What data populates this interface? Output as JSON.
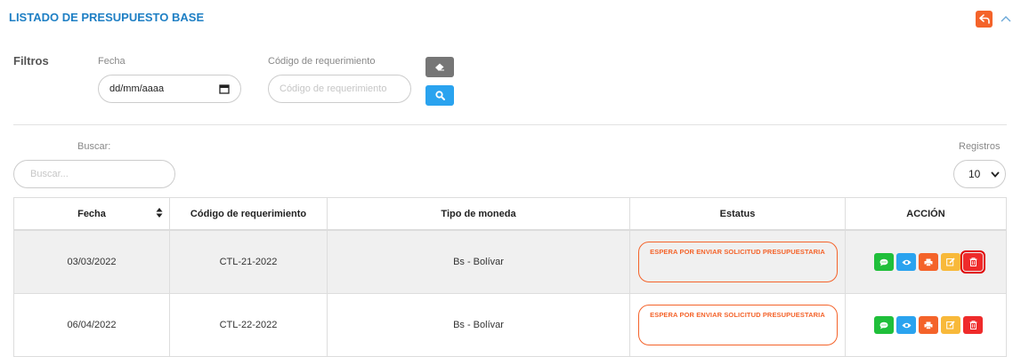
{
  "header": {
    "title": "LISTADO DE PRESUPUESTO BASE",
    "back_icon": "reply-arrow-icon",
    "collapse_icon": "chevron-up-icon"
  },
  "filters": {
    "label": "Filtros",
    "fecha_label": "Fecha",
    "fecha_value": "dd/mm/aaaa",
    "codigo_label": "Código de requerimiento",
    "codigo_placeholder": "Código de requerimiento",
    "clear_icon": "eraser-icon",
    "search_icon": "search-icon"
  },
  "table_controls": {
    "buscar_label": "Buscar:",
    "buscar_placeholder": "Buscar...",
    "registros_label": "Registros",
    "registros_value": "10"
  },
  "table": {
    "headers": [
      "Fecha",
      "Código de requerimiento",
      "Tipo de moneda",
      "Estatus",
      "ACCIÓN"
    ],
    "rows": [
      {
        "fecha": "03/03/2022",
        "codigo": "CTL-21-2022",
        "moneda": "Bs - Bolívar",
        "estatus": "ESPERA POR ENVIAR SOLICITUD PRESUPUESTARIA"
      },
      {
        "fecha": "06/04/2022",
        "codigo": "CTL-22-2022",
        "moneda": "Bs - Bolívar",
        "estatus": "ESPERA POR ENVIAR SOLICITUD PRESUPUESTARIA"
      }
    ]
  },
  "colors": {
    "accent": "#1e7fc4",
    "status_orange": "#f4632a",
    "comment_green": "#1fbf3a",
    "view_blue": "#2aa3ef",
    "edit_yellow": "#f8b93a",
    "delete_red": "#ef2b2b"
  }
}
